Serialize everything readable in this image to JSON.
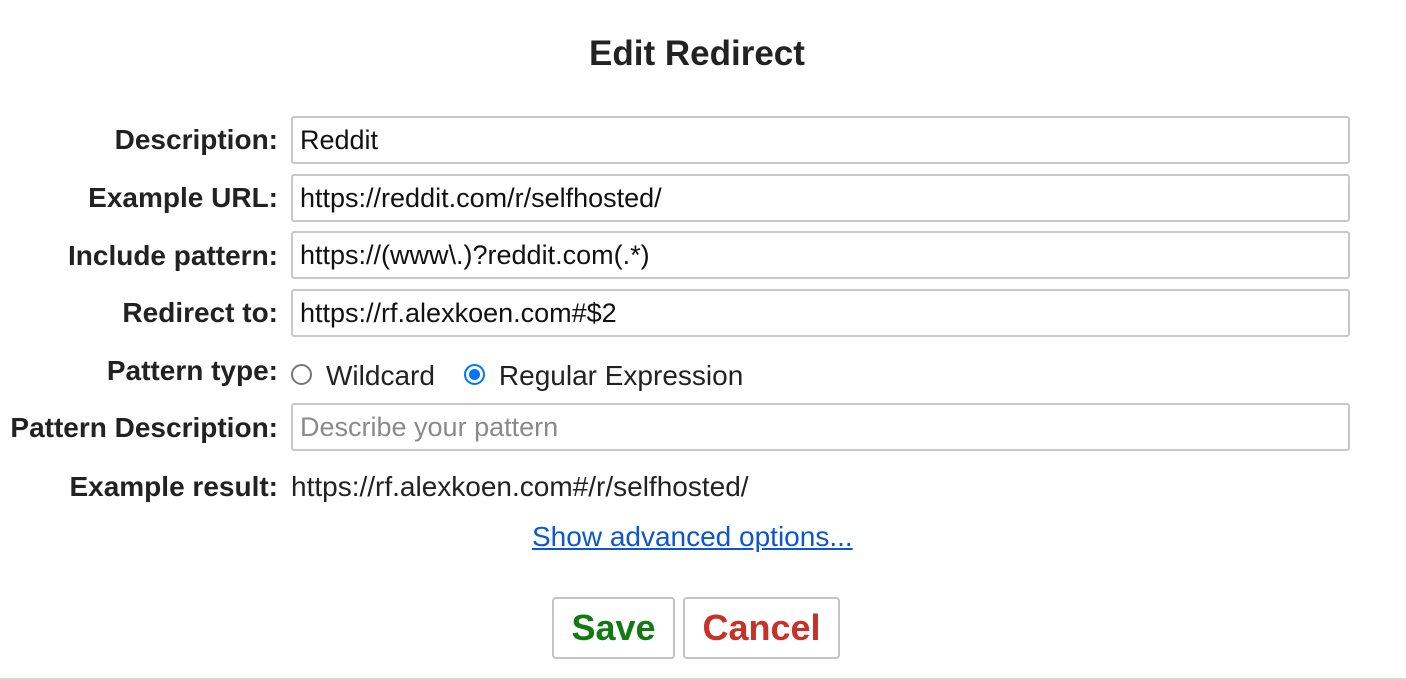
{
  "dialog": {
    "title": "Edit Redirect"
  },
  "form": {
    "description": {
      "label": "Description:",
      "value": "Reddit"
    },
    "example_url": {
      "label": "Example URL:",
      "value": "https://reddit.com/r/selfhosted/"
    },
    "include_pattern": {
      "label": "Include pattern:",
      "value": "https://(www\\.)?reddit.com(.*)"
    },
    "redirect_to": {
      "label": "Redirect to:",
      "value": "https://rf.alexkoen.com#$2"
    },
    "pattern_type": {
      "label": "Pattern type:",
      "options": [
        {
          "label": "Wildcard",
          "checked": false
        },
        {
          "label": "Regular Expression",
          "checked": true
        }
      ]
    },
    "pattern_description": {
      "label": "Pattern Description:",
      "value": "",
      "placeholder": "Describe your pattern"
    },
    "example_result": {
      "label": "Example result:",
      "value": "https://rf.alexkoen.com#/r/selfhosted/"
    }
  },
  "links": {
    "advanced": "Show advanced options..."
  },
  "buttons": {
    "save": "Save",
    "cancel": "Cancel"
  },
  "colors": {
    "save_text": "#127a12",
    "cancel_text": "#c63228",
    "link": "#0b57d0",
    "radio_accent": "#0075ff"
  }
}
